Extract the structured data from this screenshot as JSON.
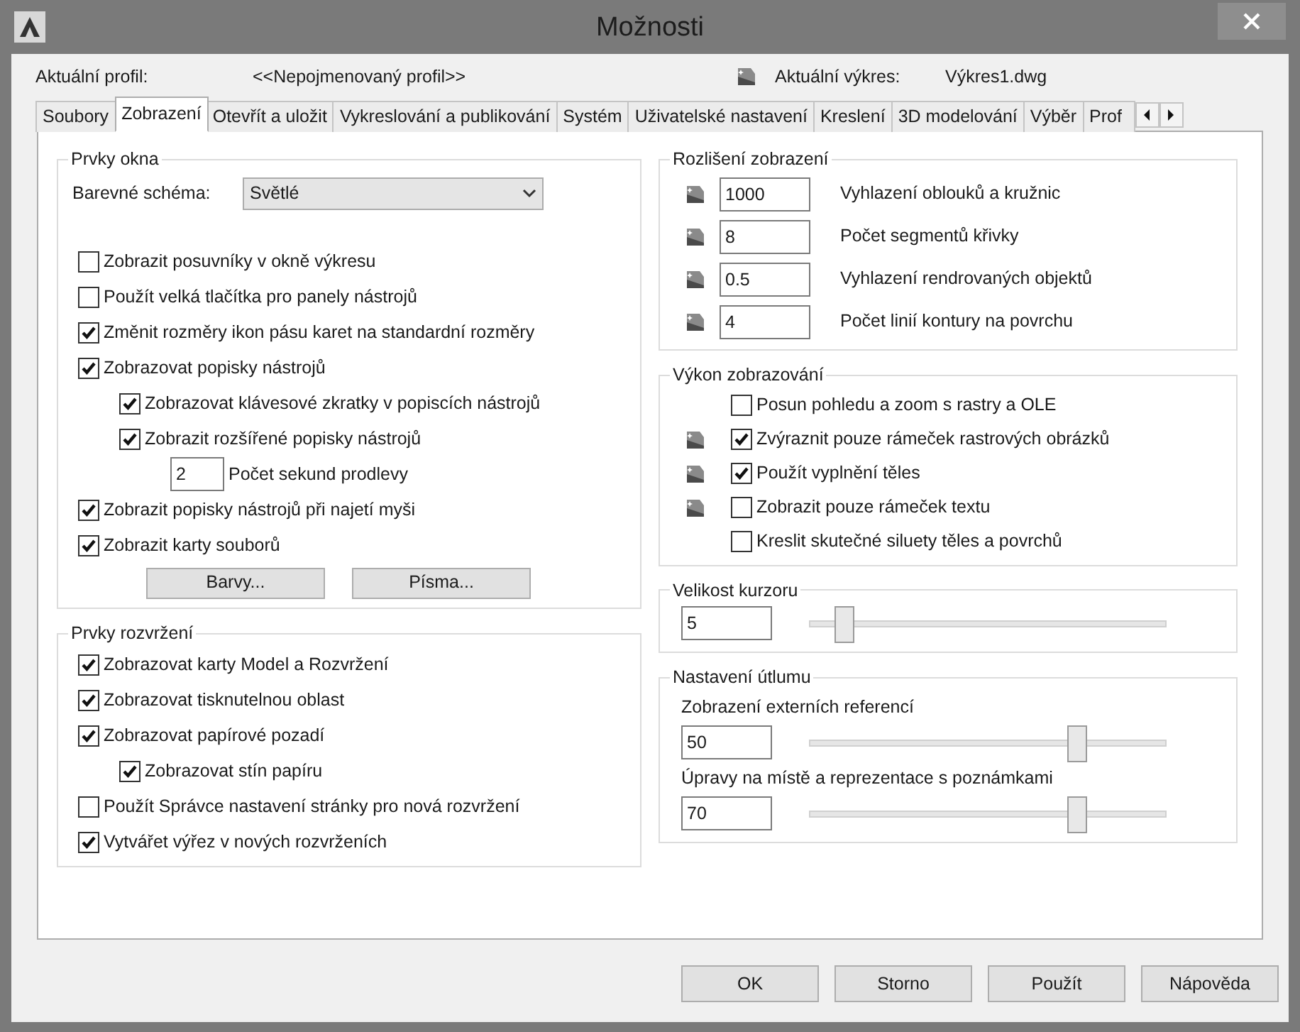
{
  "window": {
    "title": "Možnosti"
  },
  "profile": {
    "label": "Aktuální profil:",
    "value": "<<Nepojmenovaný profil>>"
  },
  "drawing": {
    "label": "Aktuální výkres:",
    "value": "Výkres1.dwg"
  },
  "tabs": [
    {
      "label": "Soubory",
      "selected": false
    },
    {
      "label": "Zobrazení",
      "selected": true
    },
    {
      "label": "Otevřít a uložit",
      "selected": false
    },
    {
      "label": "Vykreslování a publikování",
      "selected": false
    },
    {
      "label": "Systém",
      "selected": false
    },
    {
      "label": "Uživatelské nastavení",
      "selected": false
    },
    {
      "label": "Kreslení",
      "selected": false
    },
    {
      "label": "3D modelování",
      "selected": false
    },
    {
      "label": "Výběr",
      "selected": false
    },
    {
      "label": "Prof",
      "selected": false
    }
  ],
  "window_elements": {
    "title": "Prvky okna",
    "color_scheme": {
      "label": "Barevné schéma:",
      "value": "Světlé"
    },
    "items": [
      {
        "kind": "checkbox",
        "label": "Zobrazit posuvníky v okně výkresu",
        "checked": false
      },
      {
        "kind": "checkbox",
        "label": "Použít velká tlačítka pro panely nástrojů",
        "checked": false
      },
      {
        "kind": "checkbox",
        "label": "Změnit rozměry ikon pásu karet na standardní rozměry",
        "checked": true
      },
      {
        "kind": "checkbox",
        "label": "Zobrazovat popisky nástrojů",
        "checked": true,
        "children": [
          {
            "kind": "checkbox",
            "label": "Zobrazovat klávesové zkratky v popiscích nástrojů",
            "checked": true
          },
          {
            "kind": "checkbox",
            "label": "Zobrazit rozšířené popisky nástrojů",
            "checked": true,
            "children": [
              {
                "kind": "number",
                "value": "2",
                "label": "Počet sekund prodlevy"
              }
            ]
          }
        ]
      },
      {
        "kind": "checkbox",
        "label": "Zobrazit popisky nástrojů při najetí myši",
        "checked": true
      },
      {
        "kind": "checkbox",
        "label": "Zobrazit karty souborů",
        "checked": true
      }
    ],
    "buttons": [
      "Barvy...",
      "Písma..."
    ]
  },
  "layout_elements": {
    "title": "Prvky rozvržení",
    "items": [
      {
        "kind": "checkbox",
        "label": "Zobrazovat karty Model a Rozvržení",
        "checked": true
      },
      {
        "kind": "checkbox",
        "label": "Zobrazovat tisknutelnou oblast",
        "checked": true
      },
      {
        "kind": "checkbox",
        "label": "Zobrazovat papírové pozadí",
        "checked": true,
        "children": [
          {
            "kind": "checkbox",
            "label": "Zobrazovat stín papíru",
            "checked": true
          }
        ]
      },
      {
        "kind": "checkbox",
        "label": "Použít Správce nastavení stránky pro nová rozvržení",
        "checked": false
      },
      {
        "kind": "checkbox",
        "label": "Vytvářet výřez v nových rozvrženích",
        "checked": true
      }
    ]
  },
  "display_resolution": {
    "title": "Rozlišení zobrazení",
    "rows": [
      {
        "value": "1000",
        "label": "Vyhlazení oblouků a kružnic",
        "saved_in_drawing": true
      },
      {
        "value": "8",
        "label": "Počet segmentů křivky",
        "saved_in_drawing": true
      },
      {
        "value": "0.5",
        "label": "Vyhlazení rendrovaných objektů",
        "saved_in_drawing": true
      },
      {
        "value": "4",
        "label": "Počet linií kontury na povrchu",
        "saved_in_drawing": true
      }
    ]
  },
  "display_performance": {
    "title": "Výkon zobrazování",
    "items": [
      {
        "label": "Posun pohledu a zoom s rastry a OLE",
        "checked": false,
        "saved_in_drawing": false
      },
      {
        "label": "Zvýraznit pouze rámeček rastrových obrázků",
        "checked": true,
        "saved_in_drawing": true
      },
      {
        "label": "Použít vyplnění těles",
        "checked": true,
        "saved_in_drawing": true
      },
      {
        "label": "Zobrazit pouze rámeček textu",
        "checked": false,
        "saved_in_drawing": true
      },
      {
        "label": "Kreslit skutečné siluety těles a povrchů",
        "checked": false,
        "saved_in_drawing": false
      }
    ]
  },
  "crosshair_size": {
    "title": "Velikost kurzoru",
    "value": "5",
    "level": 0.07
  },
  "fade_control": {
    "title": "Nastavení útlumu",
    "items": [
      {
        "label": "Zobrazení externích referencí",
        "value": "50",
        "level": 0.76
      },
      {
        "label": "Úpravy na místě a reprezentace s poznámkami",
        "value": "70",
        "level": 0.76
      }
    ]
  },
  "buttons": [
    "OK",
    "Storno",
    "Použít",
    "Nápověda"
  ]
}
